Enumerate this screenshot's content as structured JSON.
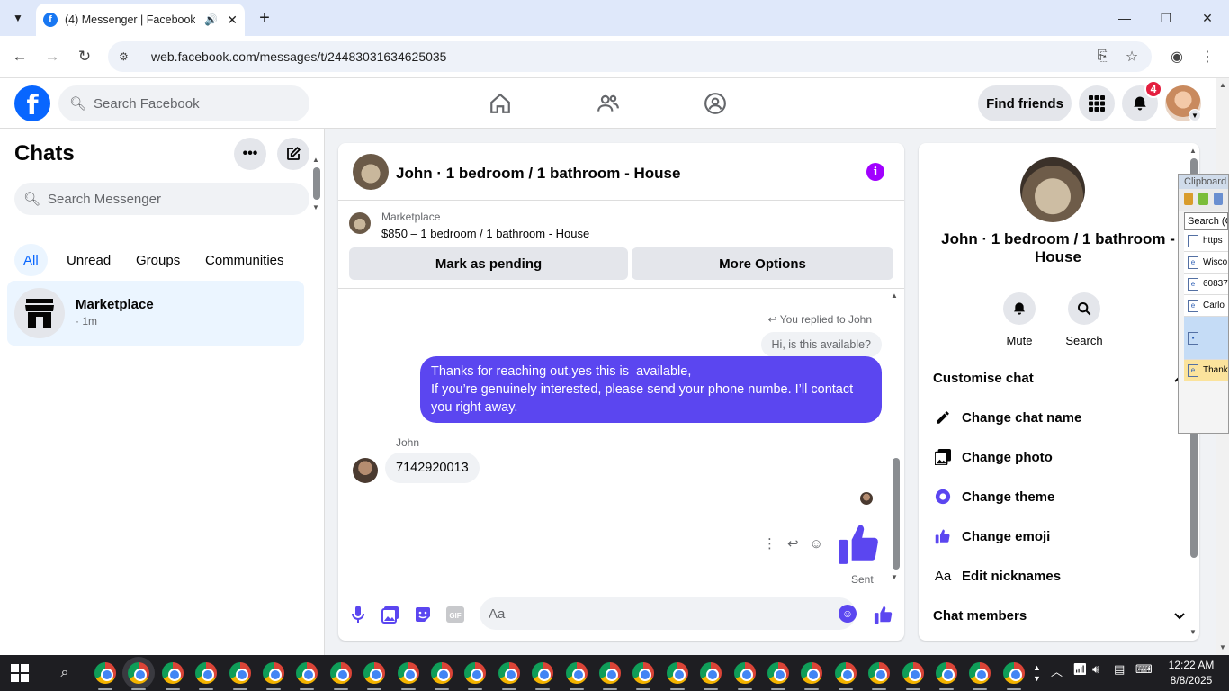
{
  "browser": {
    "tab_title": "(4) Messenger | Facebook",
    "tab_favicon": "f",
    "url": "web.facebook.com/messages/t/24483031634625035"
  },
  "fb_header": {
    "logo_letter": "f",
    "search_placeholder": "Search Facebook",
    "find_friends": "Find friends",
    "notification_count": "4"
  },
  "left": {
    "title": "Chats",
    "search_placeholder": "Search Messenger",
    "filters": [
      "All",
      "Unread",
      "Groups",
      "Communities"
    ],
    "active_filter": "All",
    "chat_item": {
      "name": "Marketplace",
      "time": "· 1m"
    }
  },
  "chat": {
    "title": "John · 1 bedroom / 1 bathroom - House",
    "marketplace_label": "Marketplace",
    "listing": "$850 – 1 bedroom / 1 bathroom - House",
    "btn_pending": "Mark as pending",
    "btn_more": "More Options",
    "replied_note": "You replied to John",
    "quoted_message": "Hi, is this available?",
    "outgoing_message": "Thanks for reaching out,yes this is  available,\nIf you’re genuinely interested, please send your phone numbe. I’ll contact you right away.",
    "sender_name": "John",
    "incoming_message": "7142920013",
    "sent_label": "Sent",
    "composer_placeholder": "Aa",
    "accent_color": "#5b46f0"
  },
  "info": {
    "name": "John · 1 bedroom / 1 bathroom - House",
    "mute_label": "Mute",
    "search_label": "Search",
    "customise_chat": "Customise chat",
    "options": [
      "Change chat name",
      "Change photo",
      "Change theme",
      "Change emoji",
      "Edit nicknames"
    ],
    "chat_members": "Chat members",
    "nickname_icon_text": "Aa"
  },
  "clipboard": {
    "title": "Clipboard",
    "search_placeholder": "Search (C",
    "items": [
      "https",
      "Wisco",
      "60837",
      "Carlo",
      "",
      "Thank"
    ]
  },
  "taskbar": {
    "time": "12:22 AM",
    "date": "8/8/2025"
  }
}
